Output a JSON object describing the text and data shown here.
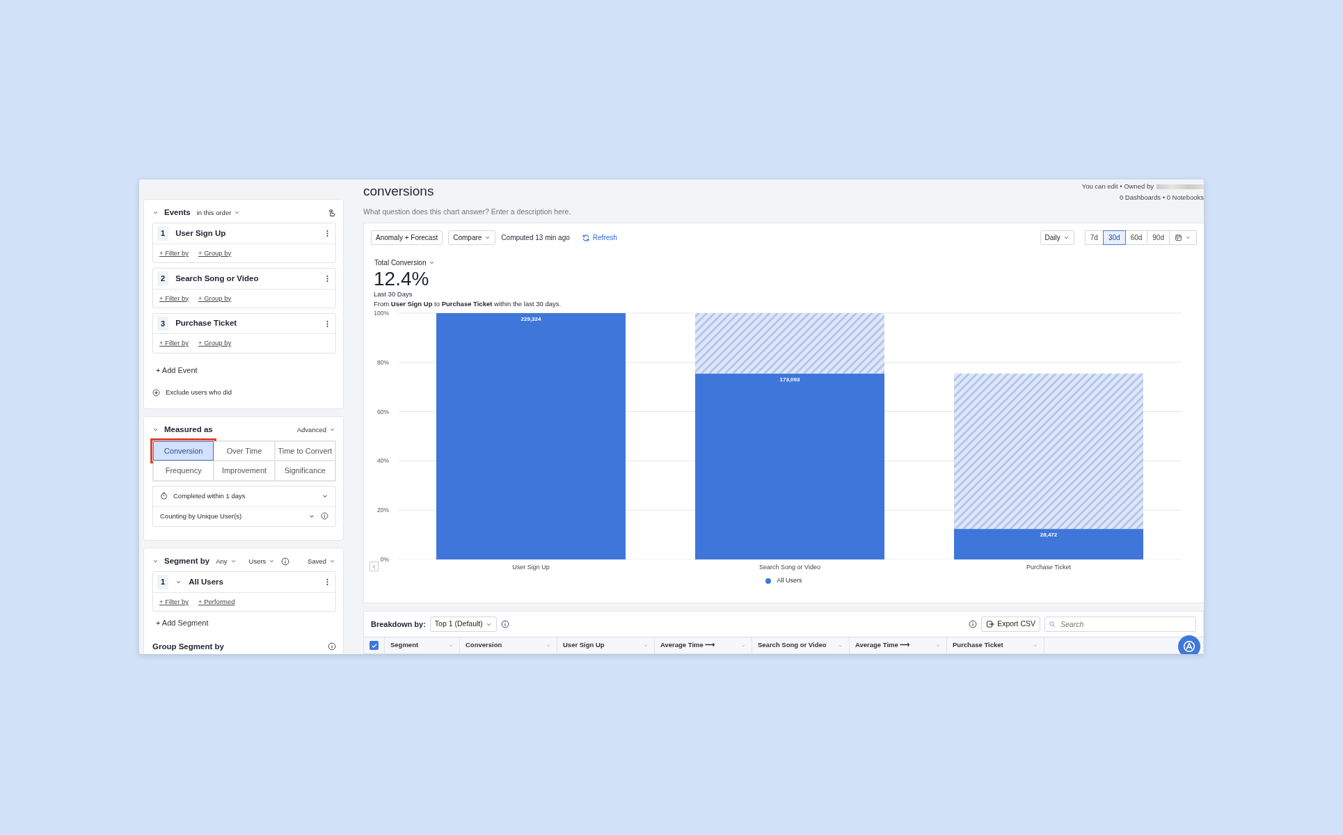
{
  "header": {
    "title": "conversions",
    "description_placeholder": "What question does this chart answer? Enter a description here.",
    "ownership": "You can edit • Owned by",
    "links": "0 Dashboards • 0 Notebooks"
  },
  "events_panel": {
    "title": "Events",
    "order": "in this order",
    "events": [
      {
        "number": "1",
        "name": "User Sign Up",
        "filter": "+ Filter by",
        "group": "+ Group by"
      },
      {
        "number": "2",
        "name": "Search Song or Video",
        "filter": "+ Filter by",
        "group": "+ Group by"
      },
      {
        "number": "3",
        "name": "Purchase Ticket",
        "filter": "+ Filter by",
        "group": "+ Group by"
      }
    ],
    "add": "+ Add Event",
    "exclude": "Exclude users who did"
  },
  "measured_panel": {
    "title": "Measured as",
    "advanced": "Advanced",
    "options": [
      {
        "label": "Conversion",
        "selected": true,
        "highlighted": true
      },
      {
        "label": "Over Time",
        "selected": false,
        "highlighted": false
      },
      {
        "label": "Time to Convert",
        "selected": false,
        "highlighted": false
      },
      {
        "label": "Frequency",
        "selected": false,
        "highlighted": false
      },
      {
        "label": "Improvement",
        "selected": false,
        "highlighted": false
      },
      {
        "label": "Significance",
        "selected": false,
        "highlighted": false
      }
    ],
    "completed": "Completed within 1 days",
    "counting": "Counting by Unique User(s)"
  },
  "segment_panel": {
    "title": "Segment by",
    "any": "Any",
    "users": "Users",
    "saved": "Saved",
    "segments": [
      {
        "number": "1",
        "name": "All Users",
        "filter": "+ Filter by",
        "performed": "+ Performed"
      }
    ],
    "add": "+ Add Segment",
    "group_title": "Group Segment by"
  },
  "toolbar": {
    "anomaly": "Anomaly + Forecast",
    "compare": "Compare",
    "computed": "Computed 13 min ago",
    "refresh": "Refresh",
    "interval": "Daily",
    "ranges": [
      {
        "label": "7d",
        "selected": false
      },
      {
        "label": "30d",
        "selected": true
      },
      {
        "label": "60d",
        "selected": false
      },
      {
        "label": "90d",
        "selected": false
      }
    ]
  },
  "summary": {
    "metric": "Total Conversion",
    "value": "12.4%",
    "period": "Last 30 Days",
    "description": "From **User Sign Up** to **Purchase Ticket** within the last 30 days."
  },
  "chart_data": {
    "type": "bar",
    "categories": [
      "User Sign Up",
      "Search Song or Video",
      "Purchase Ticket"
    ],
    "series": [
      {
        "name": "All Users",
        "color": "#3f76d9",
        "values": [
          100,
          75.5,
          12.4
        ]
      },
      {
        "color": "#b3c6ec",
        "values": [
          null,
          24.5,
          63.1
        ]
      }
    ],
    "stacked": true,
    "grid": true,
    "ylim": [
      0,
      100
    ],
    "yticks": [
      {
        "value": 0,
        "label": "0%"
      },
      {
        "value": 20,
        "label": "20%"
      },
      {
        "value": 40,
        "label": "40%"
      },
      {
        "value": 60,
        "label": "60%"
      },
      {
        "value": 80,
        "label": "80%"
      },
      {
        "value": 100,
        "label": "100%"
      }
    ],
    "value_labels": [
      "229,324",
      "173,093",
      "28,472"
    ]
  },
  "breakdown": {
    "label": "Breakdown by:",
    "value": "Top 1 (Default)",
    "export": "Export CSV",
    "search_placeholder": "Search",
    "select_all_checked": true,
    "columns": [
      "Segment",
      "Conversion",
      "User Sign Up",
      "Average Time ⟶",
      "Search Song or Video",
      "Average Time ⟶",
      "Purchase Ticket"
    ]
  }
}
